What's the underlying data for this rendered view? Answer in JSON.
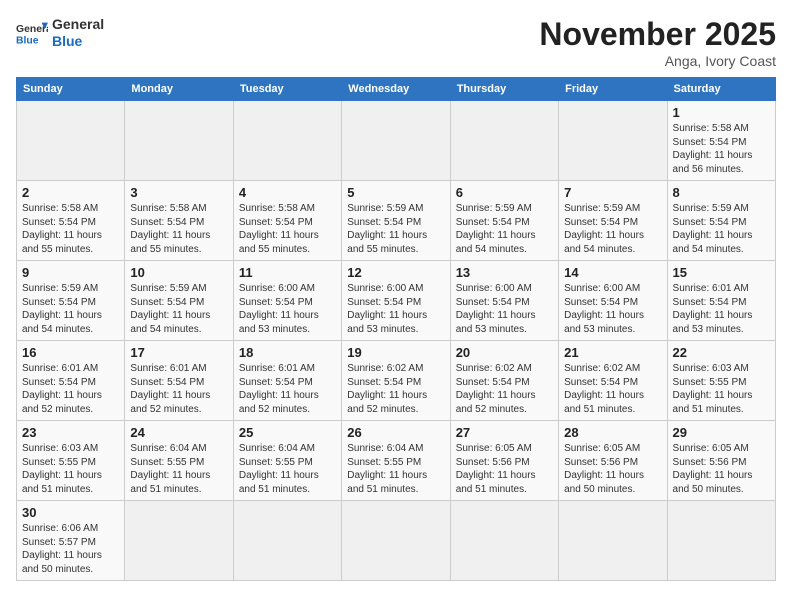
{
  "header": {
    "logo_general": "General",
    "logo_blue": "Blue",
    "month_title": "November 2025",
    "location": "Anga, Ivory Coast"
  },
  "weekdays": [
    "Sunday",
    "Monday",
    "Tuesday",
    "Wednesday",
    "Thursday",
    "Friday",
    "Saturday"
  ],
  "weeks": [
    [
      {
        "day": "",
        "info": ""
      },
      {
        "day": "",
        "info": ""
      },
      {
        "day": "",
        "info": ""
      },
      {
        "day": "",
        "info": ""
      },
      {
        "day": "",
        "info": ""
      },
      {
        "day": "",
        "info": ""
      },
      {
        "day": "1",
        "info": "Sunrise: 5:58 AM\nSunset: 5:54 PM\nDaylight: 11 hours\nand 56 minutes."
      }
    ],
    [
      {
        "day": "2",
        "info": "Sunrise: 5:58 AM\nSunset: 5:54 PM\nDaylight: 11 hours\nand 55 minutes."
      },
      {
        "day": "3",
        "info": "Sunrise: 5:58 AM\nSunset: 5:54 PM\nDaylight: 11 hours\nand 55 minutes."
      },
      {
        "day": "4",
        "info": "Sunrise: 5:58 AM\nSunset: 5:54 PM\nDaylight: 11 hours\nand 55 minutes."
      },
      {
        "day": "5",
        "info": "Sunrise: 5:59 AM\nSunset: 5:54 PM\nDaylight: 11 hours\nand 55 minutes."
      },
      {
        "day": "6",
        "info": "Sunrise: 5:59 AM\nSunset: 5:54 PM\nDaylight: 11 hours\nand 54 minutes."
      },
      {
        "day": "7",
        "info": "Sunrise: 5:59 AM\nSunset: 5:54 PM\nDaylight: 11 hours\nand 54 minutes."
      },
      {
        "day": "8",
        "info": "Sunrise: 5:59 AM\nSunset: 5:54 PM\nDaylight: 11 hours\nand 54 minutes."
      }
    ],
    [
      {
        "day": "9",
        "info": "Sunrise: 5:59 AM\nSunset: 5:54 PM\nDaylight: 11 hours\nand 54 minutes."
      },
      {
        "day": "10",
        "info": "Sunrise: 5:59 AM\nSunset: 5:54 PM\nDaylight: 11 hours\nand 54 minutes."
      },
      {
        "day": "11",
        "info": "Sunrise: 6:00 AM\nSunset: 5:54 PM\nDaylight: 11 hours\nand 53 minutes."
      },
      {
        "day": "12",
        "info": "Sunrise: 6:00 AM\nSunset: 5:54 PM\nDaylight: 11 hours\nand 53 minutes."
      },
      {
        "day": "13",
        "info": "Sunrise: 6:00 AM\nSunset: 5:54 PM\nDaylight: 11 hours\nand 53 minutes."
      },
      {
        "day": "14",
        "info": "Sunrise: 6:00 AM\nSunset: 5:54 PM\nDaylight: 11 hours\nand 53 minutes."
      },
      {
        "day": "15",
        "info": "Sunrise: 6:01 AM\nSunset: 5:54 PM\nDaylight: 11 hours\nand 53 minutes."
      }
    ],
    [
      {
        "day": "16",
        "info": "Sunrise: 6:01 AM\nSunset: 5:54 PM\nDaylight: 11 hours\nand 52 minutes."
      },
      {
        "day": "17",
        "info": "Sunrise: 6:01 AM\nSunset: 5:54 PM\nDaylight: 11 hours\nand 52 minutes."
      },
      {
        "day": "18",
        "info": "Sunrise: 6:01 AM\nSunset: 5:54 PM\nDaylight: 11 hours\nand 52 minutes."
      },
      {
        "day": "19",
        "info": "Sunrise: 6:02 AM\nSunset: 5:54 PM\nDaylight: 11 hours\nand 52 minutes."
      },
      {
        "day": "20",
        "info": "Sunrise: 6:02 AM\nSunset: 5:54 PM\nDaylight: 11 hours\nand 52 minutes."
      },
      {
        "day": "21",
        "info": "Sunrise: 6:02 AM\nSunset: 5:54 PM\nDaylight: 11 hours\nand 51 minutes."
      },
      {
        "day": "22",
        "info": "Sunrise: 6:03 AM\nSunset: 5:55 PM\nDaylight: 11 hours\nand 51 minutes."
      }
    ],
    [
      {
        "day": "23",
        "info": "Sunrise: 6:03 AM\nSunset: 5:55 PM\nDaylight: 11 hours\nand 51 minutes."
      },
      {
        "day": "24",
        "info": "Sunrise: 6:04 AM\nSunset: 5:55 PM\nDaylight: 11 hours\nand 51 minutes."
      },
      {
        "day": "25",
        "info": "Sunrise: 6:04 AM\nSunset: 5:55 PM\nDaylight: 11 hours\nand 51 minutes."
      },
      {
        "day": "26",
        "info": "Sunrise: 6:04 AM\nSunset: 5:55 PM\nDaylight: 11 hours\nand 51 minutes."
      },
      {
        "day": "27",
        "info": "Sunrise: 6:05 AM\nSunset: 5:56 PM\nDaylight: 11 hours\nand 51 minutes."
      },
      {
        "day": "28",
        "info": "Sunrise: 6:05 AM\nSunset: 5:56 PM\nDaylight: 11 hours\nand 50 minutes."
      },
      {
        "day": "29",
        "info": "Sunrise: 6:05 AM\nSunset: 5:56 PM\nDaylight: 11 hours\nand 50 minutes."
      }
    ],
    [
      {
        "day": "30",
        "info": "Sunrise: 6:06 AM\nSunset: 5:57 PM\nDaylight: 11 hours\nand 50 minutes."
      },
      {
        "day": "",
        "info": ""
      },
      {
        "day": "",
        "info": ""
      },
      {
        "day": "",
        "info": ""
      },
      {
        "day": "",
        "info": ""
      },
      {
        "day": "",
        "info": ""
      },
      {
        "day": "",
        "info": ""
      }
    ]
  ]
}
